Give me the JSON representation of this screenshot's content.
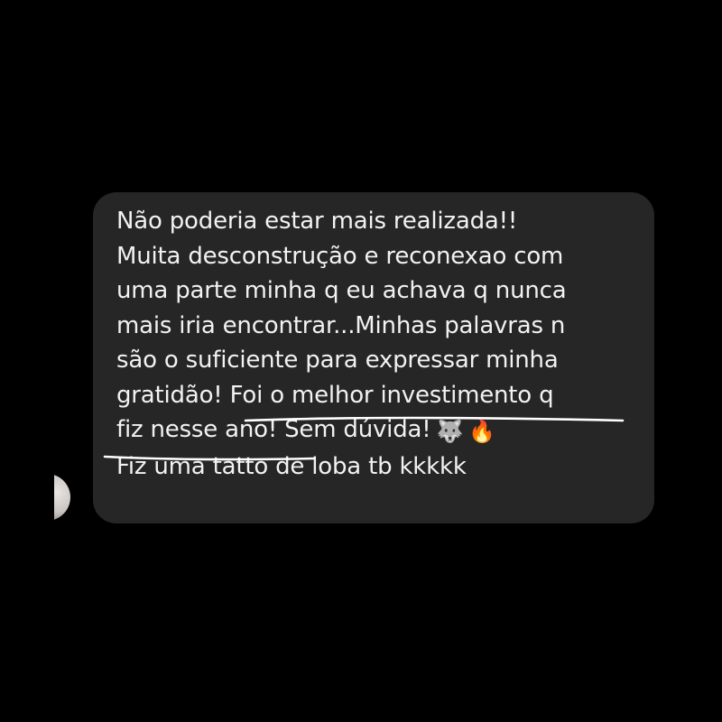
{
  "message": {
    "lines": [
      "Não poderia estar mais realizada!!",
      "Muita desconstrução e reconexao com",
      "uma parte minha q eu achava q nunca",
      "mais iria encontrar...Minhas palavras n",
      "são o suficiente para expressar minha",
      "gratidão! Foi o melhor investimento q",
      "fiz nesse ano! Sem dúvida!",
      "Fiz uma tatto de loba tb kkkkk"
    ],
    "emojis": [
      "🐺",
      "🔥"
    ]
  },
  "colors": {
    "background": "#000000",
    "bubble": "#262626",
    "text": "#f2f2f2",
    "underline": "#ffffff"
  },
  "icons": {
    "avatar": "avatar-icon",
    "emoji_1": "wolf-emoji",
    "emoji_2": "fire-emoji"
  }
}
